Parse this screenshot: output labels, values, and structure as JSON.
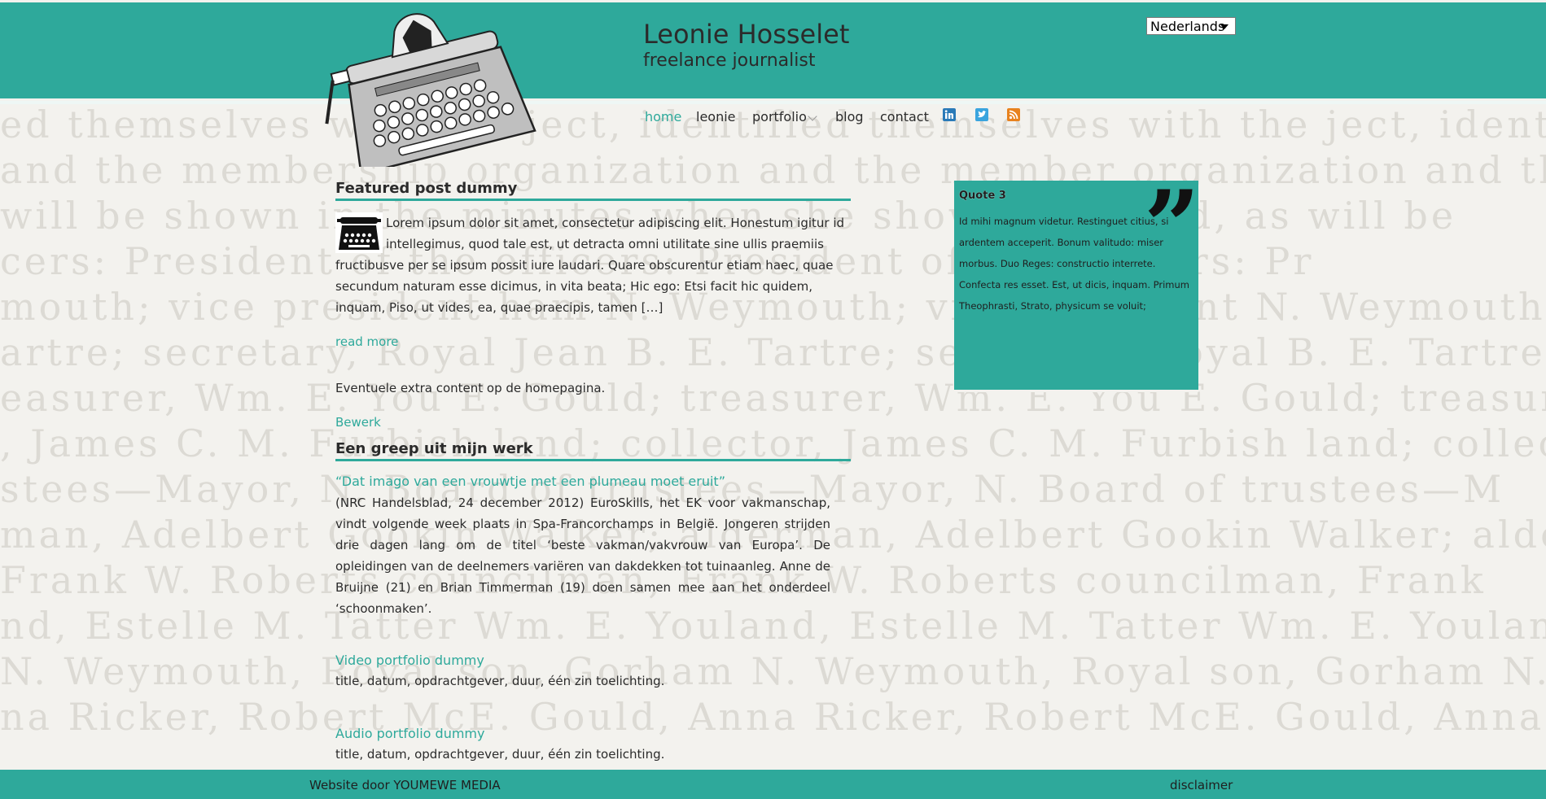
{
  "site": {
    "title": "Leonie Hosselet",
    "subtitle": "freelance journalist",
    "language": "Nederlands"
  },
  "nav": {
    "items": [
      "home",
      "leonie",
      "portfolio",
      "blog",
      "contact"
    ],
    "active": "home"
  },
  "social": {
    "icons": [
      "linkedin-icon",
      "twitter-icon",
      "rss-icon"
    ]
  },
  "background_text": [
    "ed  themselves  with  the  ject,  identified  themselves  with  the  ject,  identified  themse",
    "and the membership organization and the member organization and the members",
    "  will  be  shown  in  the  minutes  when  she  shown  released,  as  will  be",
    "cers:   President   of   the   officers:   President   of   the   officers:   Pr",
    "mouth;  vice  president  ham  N.  Weymouth;  vice  president  N.  Weymouth;  v",
    "artre;  secretary,  Royal  Jean  B.  E.  Tartre;  secretary,  Royal  B.  E.  Tartre;  se",
    "easurer,  Wm.  E.  You  E.  Gould;  treasurer,  Wm.  E.  You  E.  Gould;  treasurer,",
    ",  James  C.  M.  Furbish  land;  collector,  James  C.  M.  Furbish  land;  collector,  Jame",
    "stees—Mayor,  N.  Board  of  trustees—Mayor,  N.  Board  of  trustees—M",
    "man,  Adelbert  Gookin  Walker;  alderman,  Adelbert  Gookin  Walker;  alderman,  Ade",
    "  Frank  W.  Roberts  councilman,  Frank  W.  Roberts  councilman,  Frank",
    "nd,  Estelle  M.  Tatter  Wm.  E.  Youland,  Estelle  M.  Tatter  Wm.  E.  Youland,  Este",
    "  N.  Weymouth,  Royal  son,  Gorham  N.  Weymouth,  Royal  son,  Gorham  N.  Wey",
    "na  Ricker,  Robert  McE.  Gould,  Anna  Ricker,  Robert  McE.  Gould,  Anna  Ricker"
  ],
  "featured": {
    "heading": "Featured post dummy",
    "body": "Lorem ipsum dolor sit amet, consectetur adipiscing elit. Honestum igitur id intellegimus, quod tale est, ut detracta omni utilitate sine ullis praemiis fructibusve per se ipsum possit iure laudari. Quare obscurentur etiam haec, quae secundum naturam esse dicimus, in vita beata; Hic ego: Etsi facit hic quidem, inquam, Piso, ut vides, ea, quae praecipis, tamen […]",
    "read_more": "read more"
  },
  "extra": {
    "text": "Eventuele extra content op de homepagina.",
    "edit": "Bewerk"
  },
  "work": {
    "heading": "Een greep uit mijn werk",
    "items": [
      {
        "title": "“Dat imago van een vrouwtje met een plumeau moet eruit”",
        "body": "(NRC Handelsblad, 24 december 2012) EuroSkills, het EK voor vakmanschap, vindt volgende week plaats in Spa-Francorchamps in België. Jongeren strijden drie dagen lang om de titel ‘beste vakman/vakvrouw van Europa’. De opleidingen van de deelnemers variëren van dakdekken tot tuinaanleg. Anne de Bruijne (21) en Brian Timmerman (19) doen samen mee aan het onderdeel ‘schoonmaken’."
      },
      {
        "title": "Video portfolio dummy",
        "body": "title, datum, opdrachtgever, duur, één zin toelichting."
      },
      {
        "title": "Audio portfolio dummy",
        "body": "title, datum, opdrachtgever, duur, één zin toelichting."
      }
    ]
  },
  "quote": {
    "title": "Quote 3",
    "text": "Id mihi magnum videtur. Restinguet citius, si ardentem acceperit. Bonum valitudo: miser morbus. Duo Reges: constructio interrete. Confecta res esset. Est, ut dicis, inquam. Primum Theophrasti, Strato, physicum se voluit;",
    "mark": "”"
  },
  "footer": {
    "credit": "Website door YOUMEWE MEDIA",
    "disclaimer": "disclaimer"
  },
  "colors": {
    "accent": "#2ea99b",
    "text": "#2b2b2b",
    "background": "#f3f2ee"
  }
}
